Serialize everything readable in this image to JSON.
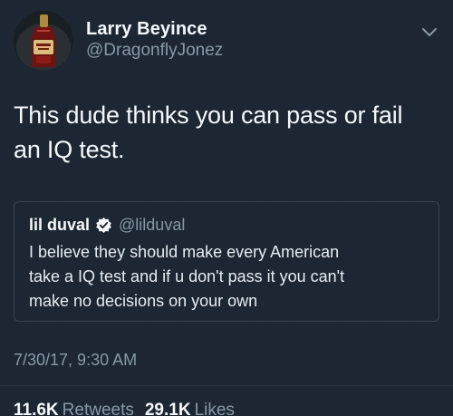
{
  "author": {
    "display_name": "Larry Beyince",
    "handle": "@DragonflyJonez",
    "avatar_icon": "bottle-avatar"
  },
  "menu_icon": "chevron-down-icon",
  "tweet": {
    "text_line1": "This dude thinks you can pass or fail",
    "text_line2": "an IQ test."
  },
  "quoted_tweet": {
    "display_name": "lil duval",
    "verified_icon": "verified-badge-icon",
    "handle": "@lilduval",
    "text_line1": "I believe they should make every American",
    "text_line2": "take a IQ test and if u don't pass it you can't",
    "text_line3": "make no decisions on your own"
  },
  "timestamp": "7/30/17, 9:30 AM",
  "stats": {
    "retweets_count": "11.6K",
    "retweets_label": "Retweets",
    "likes_count": "29.1K",
    "likes_label": "Likes"
  },
  "colors": {
    "background": "#1c2733",
    "primary_text": "#f5f8fa",
    "secondary_text": "#8899a6",
    "border": "#38444d"
  }
}
